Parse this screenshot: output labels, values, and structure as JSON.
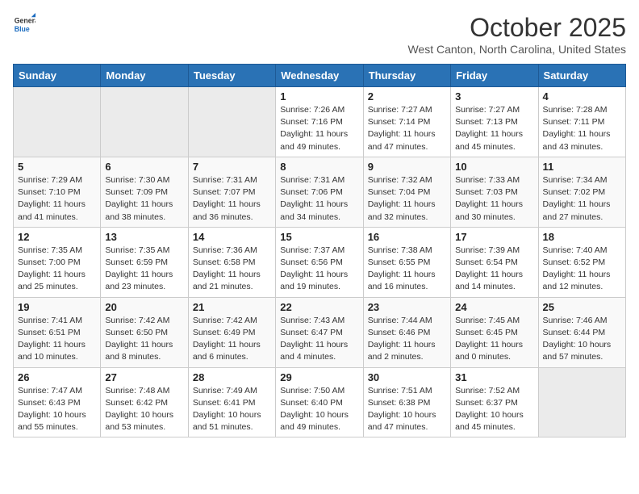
{
  "logo": {
    "general": "General",
    "blue": "Blue"
  },
  "header": {
    "month": "October 2025",
    "location": "West Canton, North Carolina, United States"
  },
  "weekdays": [
    "Sunday",
    "Monday",
    "Tuesday",
    "Wednesday",
    "Thursday",
    "Friday",
    "Saturday"
  ],
  "rows": [
    [
      {
        "day": "",
        "empty": true
      },
      {
        "day": "",
        "empty": true
      },
      {
        "day": "",
        "empty": true
      },
      {
        "day": "1",
        "sunrise": "7:26 AM",
        "sunset": "7:16 PM",
        "daylight": "11 hours and 49 minutes."
      },
      {
        "day": "2",
        "sunrise": "7:27 AM",
        "sunset": "7:14 PM",
        "daylight": "11 hours and 47 minutes."
      },
      {
        "day": "3",
        "sunrise": "7:27 AM",
        "sunset": "7:13 PM",
        "daylight": "11 hours and 45 minutes."
      },
      {
        "day": "4",
        "sunrise": "7:28 AM",
        "sunset": "7:11 PM",
        "daylight": "11 hours and 43 minutes."
      }
    ],
    [
      {
        "day": "5",
        "sunrise": "7:29 AM",
        "sunset": "7:10 PM",
        "daylight": "11 hours and 41 minutes."
      },
      {
        "day": "6",
        "sunrise": "7:30 AM",
        "sunset": "7:09 PM",
        "daylight": "11 hours and 38 minutes."
      },
      {
        "day": "7",
        "sunrise": "7:31 AM",
        "sunset": "7:07 PM",
        "daylight": "11 hours and 36 minutes."
      },
      {
        "day": "8",
        "sunrise": "7:31 AM",
        "sunset": "7:06 PM",
        "daylight": "11 hours and 34 minutes."
      },
      {
        "day": "9",
        "sunrise": "7:32 AM",
        "sunset": "7:04 PM",
        "daylight": "11 hours and 32 minutes."
      },
      {
        "day": "10",
        "sunrise": "7:33 AM",
        "sunset": "7:03 PM",
        "daylight": "11 hours and 30 minutes."
      },
      {
        "day": "11",
        "sunrise": "7:34 AM",
        "sunset": "7:02 PM",
        "daylight": "11 hours and 27 minutes."
      }
    ],
    [
      {
        "day": "12",
        "sunrise": "7:35 AM",
        "sunset": "7:00 PM",
        "daylight": "11 hours and 25 minutes."
      },
      {
        "day": "13",
        "sunrise": "7:35 AM",
        "sunset": "6:59 PM",
        "daylight": "11 hours and 23 minutes."
      },
      {
        "day": "14",
        "sunrise": "7:36 AM",
        "sunset": "6:58 PM",
        "daylight": "11 hours and 21 minutes."
      },
      {
        "day": "15",
        "sunrise": "7:37 AM",
        "sunset": "6:56 PM",
        "daylight": "11 hours and 19 minutes."
      },
      {
        "day": "16",
        "sunrise": "7:38 AM",
        "sunset": "6:55 PM",
        "daylight": "11 hours and 16 minutes."
      },
      {
        "day": "17",
        "sunrise": "7:39 AM",
        "sunset": "6:54 PM",
        "daylight": "11 hours and 14 minutes."
      },
      {
        "day": "18",
        "sunrise": "7:40 AM",
        "sunset": "6:52 PM",
        "daylight": "11 hours and 12 minutes."
      }
    ],
    [
      {
        "day": "19",
        "sunrise": "7:41 AM",
        "sunset": "6:51 PM",
        "daylight": "11 hours and 10 minutes."
      },
      {
        "day": "20",
        "sunrise": "7:42 AM",
        "sunset": "6:50 PM",
        "daylight": "11 hours and 8 minutes."
      },
      {
        "day": "21",
        "sunrise": "7:42 AM",
        "sunset": "6:49 PM",
        "daylight": "11 hours and 6 minutes."
      },
      {
        "day": "22",
        "sunrise": "7:43 AM",
        "sunset": "6:47 PM",
        "daylight": "11 hours and 4 minutes."
      },
      {
        "day": "23",
        "sunrise": "7:44 AM",
        "sunset": "6:46 PM",
        "daylight": "11 hours and 2 minutes."
      },
      {
        "day": "24",
        "sunrise": "7:45 AM",
        "sunset": "6:45 PM",
        "daylight": "11 hours and 0 minutes."
      },
      {
        "day": "25",
        "sunrise": "7:46 AM",
        "sunset": "6:44 PM",
        "daylight": "10 hours and 57 minutes."
      }
    ],
    [
      {
        "day": "26",
        "sunrise": "7:47 AM",
        "sunset": "6:43 PM",
        "daylight": "10 hours and 55 minutes."
      },
      {
        "day": "27",
        "sunrise": "7:48 AM",
        "sunset": "6:42 PM",
        "daylight": "10 hours and 53 minutes."
      },
      {
        "day": "28",
        "sunrise": "7:49 AM",
        "sunset": "6:41 PM",
        "daylight": "10 hours and 51 minutes."
      },
      {
        "day": "29",
        "sunrise": "7:50 AM",
        "sunset": "6:40 PM",
        "daylight": "10 hours and 49 minutes."
      },
      {
        "day": "30",
        "sunrise": "7:51 AM",
        "sunset": "6:38 PM",
        "daylight": "10 hours and 47 minutes."
      },
      {
        "day": "31",
        "sunrise": "7:52 AM",
        "sunset": "6:37 PM",
        "daylight": "10 hours and 45 minutes."
      },
      {
        "day": "",
        "empty": true
      }
    ]
  ],
  "labels": {
    "sunrise_prefix": "Sunrise: ",
    "sunset_prefix": "Sunset: ",
    "daylight_prefix": "Daylight: "
  }
}
